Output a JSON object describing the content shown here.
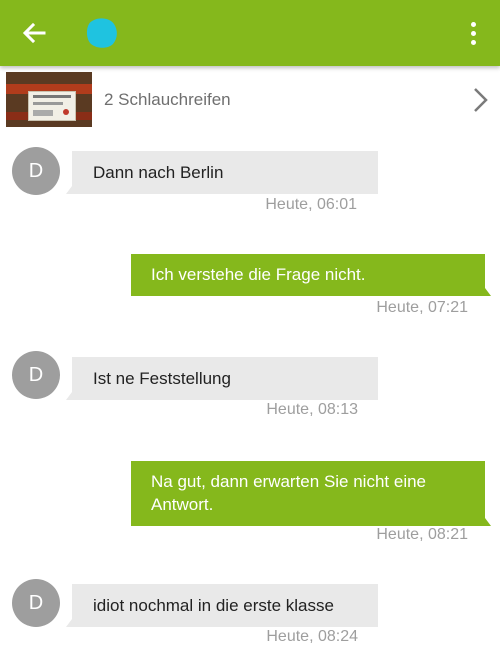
{
  "appbar": {
    "background": "#85b81c",
    "back_icon": "arrow-left-icon",
    "avatar_icon": "cyan-blob-avatar",
    "avatar_color": "#1fc3e0",
    "menu_icon": "more-vert-icon"
  },
  "item": {
    "title": "2 Schlauchreifen",
    "chevron_icon": "chevron-right-icon"
  },
  "messages": [
    {
      "direction": "incoming",
      "avatar_letter": "D",
      "text": "Dann nach Berlin",
      "time": "Heute, 06:01"
    },
    {
      "direction": "outgoing",
      "text": "Ich verstehe die Frage nicht.",
      "time": "Heute, 07:21"
    },
    {
      "direction": "incoming",
      "avatar_letter": "D",
      "text": "Ist ne Feststellung",
      "time": "Heute, 08:13"
    },
    {
      "direction": "outgoing",
      "text": "Na gut, dann erwarten Sie nicht eine Antwort.",
      "time": "Heute, 08:21"
    },
    {
      "direction": "incoming",
      "avatar_letter": "D",
      "text": "idiot nochmal in die erste klasse",
      "time": "Heute, 08:24"
    }
  ],
  "colors": {
    "accent": "#85b81c",
    "incoming_bubble": "#e9e9e9",
    "avatar_gray": "#9e9e9e",
    "timestamp": "#9e9e9e"
  }
}
